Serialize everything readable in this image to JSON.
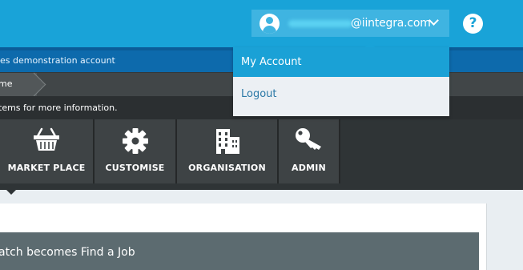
{
  "header": {
    "user_email_domain": "@iintegra.com",
    "help_label": "?",
    "accent_color": "#19a3d8"
  },
  "banner": {
    "text": "es demonstration account"
  },
  "breadcrumb": {
    "home_label": "me"
  },
  "info": {
    "text": "tems for more information."
  },
  "tiles": [
    {
      "label": "MARKET PLACE",
      "icon": "basket-icon"
    },
    {
      "label": "CUSTOMISE",
      "icon": "gear-icon"
    },
    {
      "label": "ORGANISATION",
      "icon": "buildings-icon"
    },
    {
      "label": "ADMIN",
      "icon": "key-icon"
    }
  ],
  "content": {
    "card_title": "atch becomes Find a Job"
  },
  "account_menu": {
    "items": [
      {
        "label": "My Account",
        "active": true
      },
      {
        "label": "Logout",
        "active": false
      }
    ]
  }
}
